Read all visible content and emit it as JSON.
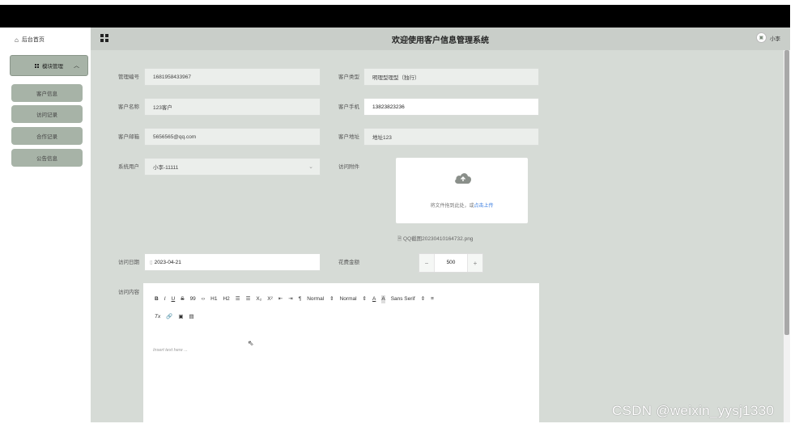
{
  "sidebar": {
    "home_label": "后台首页",
    "group_label": "模块管理",
    "items": [
      {
        "label": "客户信息"
      },
      {
        "label": "访问记录"
      },
      {
        "label": "合作记录"
      },
      {
        "label": "公告信息"
      }
    ]
  },
  "header": {
    "title": "欢迎使用客户信息管理系统",
    "user_name": "小李"
  },
  "form": {
    "manager_no_label": "管理编号",
    "manager_no_value": "1681958433967",
    "customer_type_label": "客户类型",
    "customer_type_value": "明理型理型（独行）",
    "customer_name_label": "客户名称",
    "customer_name_value": "123客户",
    "customer_phone_label": "客户手机",
    "customer_phone_value": "13823823236",
    "customer_email_label": "客户邮箱",
    "customer_email_value": "5656565@qq.com",
    "customer_address_label": "客户地址",
    "customer_address_value": "地址123",
    "system_user_label": "系统用户",
    "system_user_value": "小李-11111",
    "attachment_label": "访问附件",
    "upload_hint": "将文件拖到此处，或",
    "upload_link": "点击上传",
    "file_name": "QQ截图20230410164732.png",
    "visit_date_label": "访问日期",
    "visit_date_value": "2023-04-21",
    "cost_label": "花费金额",
    "cost_value": "500",
    "content_label": "访问内容",
    "editor_placeholder": "Insert text here ..."
  },
  "editor_toolbar": {
    "bold": "B",
    "italic": "I",
    "underline": "U",
    "strike": "S",
    "quote": "99",
    "code": "‹›",
    "h1": "H1",
    "h2": "H2",
    "ol": "☰",
    "ul": "☰",
    "sub": "X₂",
    "sup": "X²",
    "outdent": "⇤",
    "indent": "⇥",
    "rtl": "¶",
    "size1": "Normal",
    "size2": "Normal",
    "color": "A",
    "bg": "A",
    "font": "Sans Serif",
    "align": "≡",
    "clean": "Tx",
    "link": "🔗",
    "image": "▣",
    "video": "▤"
  },
  "watermark": "CSDN @weixin_yysj1330",
  "colors": {
    "header_bg": "#c9cec9",
    "main_bg": "#d6dbd6",
    "menu_bg": "#a7b3a7",
    "link": "#3a7de0"
  }
}
